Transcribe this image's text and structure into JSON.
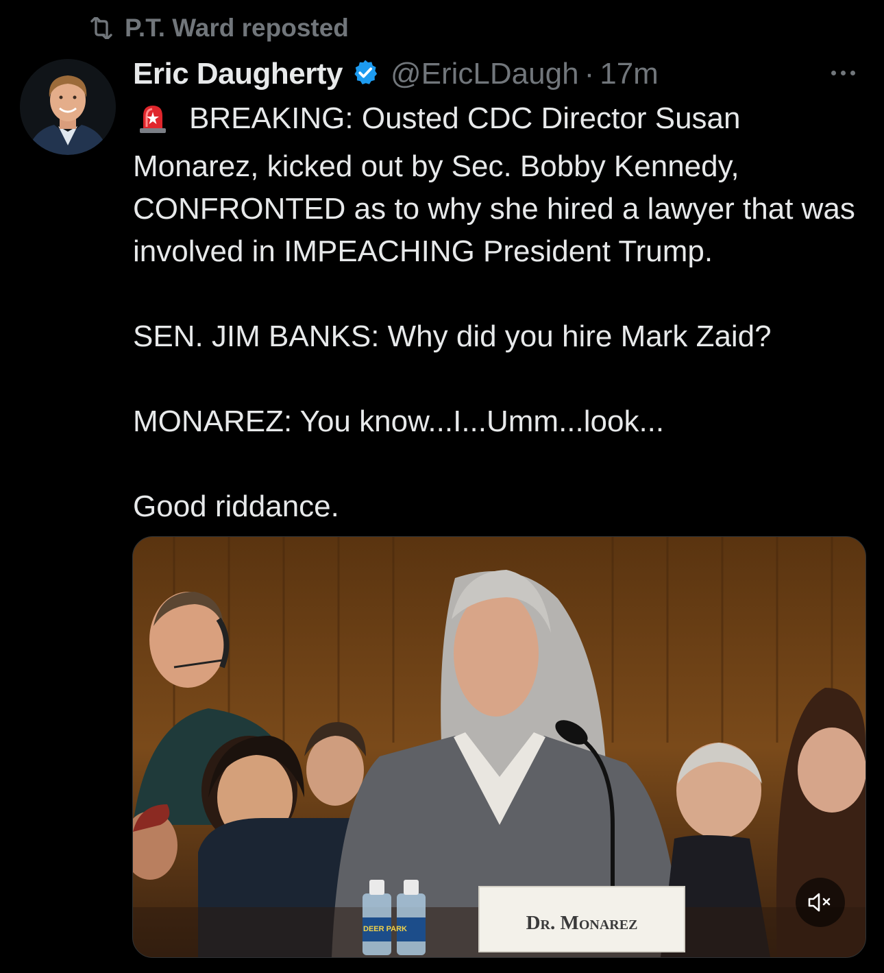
{
  "repost": {
    "icon": "repost-icon",
    "label": "P.T. Ward reposted"
  },
  "author": {
    "name": "Eric Daugherty",
    "verified_icon": "verified-badge-icon",
    "handle": "@EricLDaugh",
    "separator": "·",
    "time": "17m"
  },
  "tweet": {
    "emoji": "rotating-light-icon",
    "line1": "BREAKING: Ousted CDC Director Susan Monarez, kicked out by Sec. Bobby Kennedy, CONFRONTED as to why she hired a lawyer that was involved in IMPEACHING President Trump.",
    "line2": "SEN. JIM BANKS: Why did you hire Mark Zaid?",
    "line3": "MONAREZ: You know...I...Umm...look...",
    "line4": "Good riddance."
  },
  "media": {
    "nameplate": "Dr. Monarez",
    "bottle_label": "DEER PARK",
    "mute_icon": "muted-speaker-icon"
  },
  "colors": {
    "background": "#000000",
    "text_primary": "#e7e9ea",
    "text_secondary": "#71767b",
    "verified_blue": "#1d9bf0",
    "siren_red": "#e0262c"
  }
}
